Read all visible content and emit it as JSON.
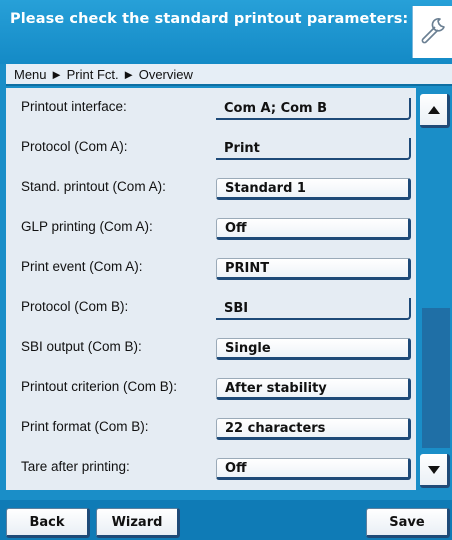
{
  "header": {
    "title": "Please check the standard printout parameters:",
    "wrench_icon": "wrench-icon"
  },
  "breadcrumb": {
    "text": "Menu ► Print Fct. ► Overview"
  },
  "rows": [
    {
      "label": "Printout interface:",
      "value": "Com A; Com B",
      "kind": "field"
    },
    {
      "label": "Protocol (Com A):",
      "value": "Print",
      "kind": "field"
    },
    {
      "label": "Stand. printout (Com A):",
      "value": "Standard 1",
      "kind": "button"
    },
    {
      "label": "GLP printing (Com A):",
      "value": "Off",
      "kind": "button"
    },
    {
      "label": "Print event (Com A):",
      "value": "PRINT",
      "kind": "button"
    },
    {
      "label": "Protocol (Com B):",
      "value": "SBI",
      "kind": "field"
    },
    {
      "label": "SBI output (Com B):",
      "value": "Single",
      "kind": "button"
    },
    {
      "label": "Printout criterion (Com B):",
      "value": "After stability",
      "kind": "button"
    },
    {
      "label": "Print format (Com B):",
      "value": "22 characters",
      "kind": "button"
    },
    {
      "label": "Tare after printing:",
      "value": "Off",
      "kind": "button"
    }
  ],
  "scrollbar": {
    "up_icon": "arrow-up-icon",
    "down_icon": "arrow-down-icon",
    "position_fraction": 0.0,
    "visible_fraction": 0.55
  },
  "footer": {
    "back_label": "Back",
    "wizard_label": "Wizard",
    "save_label": "Save"
  },
  "colors": {
    "header": "#1a8ec8",
    "panel": "#e5ecf3",
    "button_shadow": "#1e4a78"
  }
}
